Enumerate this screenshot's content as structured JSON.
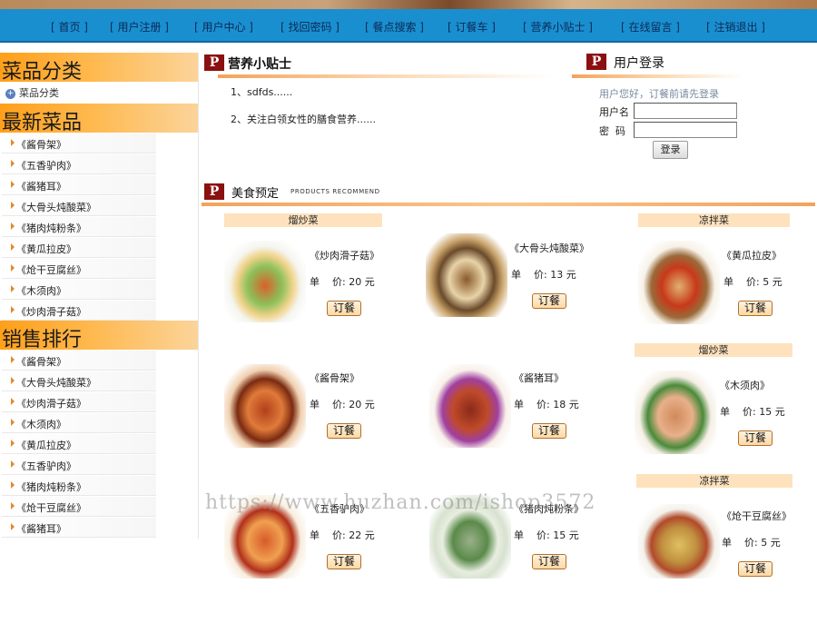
{
  "nav": [
    "[ 首页 ]",
    "[ 用户注册 ]",
    "[ 用户中心 ]",
    "[ 找回密码 ]",
    "[ 餐点搜索 ]",
    "[ 订餐车 ]",
    "[ 营养小贴士 ]",
    "[ 在线留言 ]",
    "[ 注销退出 ]"
  ],
  "left": {
    "category_title": "菜品分类",
    "category_link": "菜品分类",
    "new_title": "最新菜品",
    "new_items": [
      "《酱骨架》",
      "《五香驴肉》",
      "《酱猪耳》",
      "《大骨头炖酸菜》",
      "《猪肉炖粉条》",
      "《黄瓜拉皮》",
      "《炝干豆腐丝》",
      "《木须肉》",
      "《炒肉滑子菇》"
    ],
    "sales_title": "销售排行",
    "sales_items": [
      "《酱骨架》",
      "《大骨头炖酸菜》",
      "《炒肉滑子菇》",
      "《木须肉》",
      "《黄瓜拉皮》",
      "《五香驴肉》",
      "《猪肉炖粉条》",
      "《炝干豆腐丝》",
      "《酱猪耳》"
    ]
  },
  "tips": {
    "title": "营养小贴士",
    "items": [
      "1、sdfds......",
      "2、关注白领女性的膳食营养......"
    ]
  },
  "login": {
    "title": "用户登录",
    "note": "用户您好，订餐前请先登录",
    "username_label": "用户名",
    "password_label": "密  码",
    "button": "登录"
  },
  "food": {
    "title": "美食预定",
    "title_en": "PRODUCTS RECOMMEND",
    "categories": [
      "熘炒菜",
      "凉拌菜",
      "熘炒菜",
      "凉拌菜"
    ],
    "price_label": "单    价:",
    "order_label": "订餐",
    "dishes": [
      {
        "name": "《炒肉滑子菇》",
        "price": "20 元"
      },
      {
        "name": "《大骨头炖酸菜》",
        "price": "13 元"
      },
      {
        "name": "《黄瓜拉皮》",
        "price": "5 元"
      },
      {
        "name": "《酱骨架》",
        "price": "20 元"
      },
      {
        "name": "《酱猪耳》",
        "price": "18 元"
      },
      {
        "name": "《木须肉》",
        "price": "15 元"
      },
      {
        "name": "《五香驴肉》",
        "price": "22 元"
      },
      {
        "name": "《猪肉炖粉条》",
        "price": "15 元"
      },
      {
        "name": "《炝干豆腐丝》",
        "price": "5 元"
      }
    ]
  },
  "watermark": "https://www.huzhan.com/ishop3572"
}
